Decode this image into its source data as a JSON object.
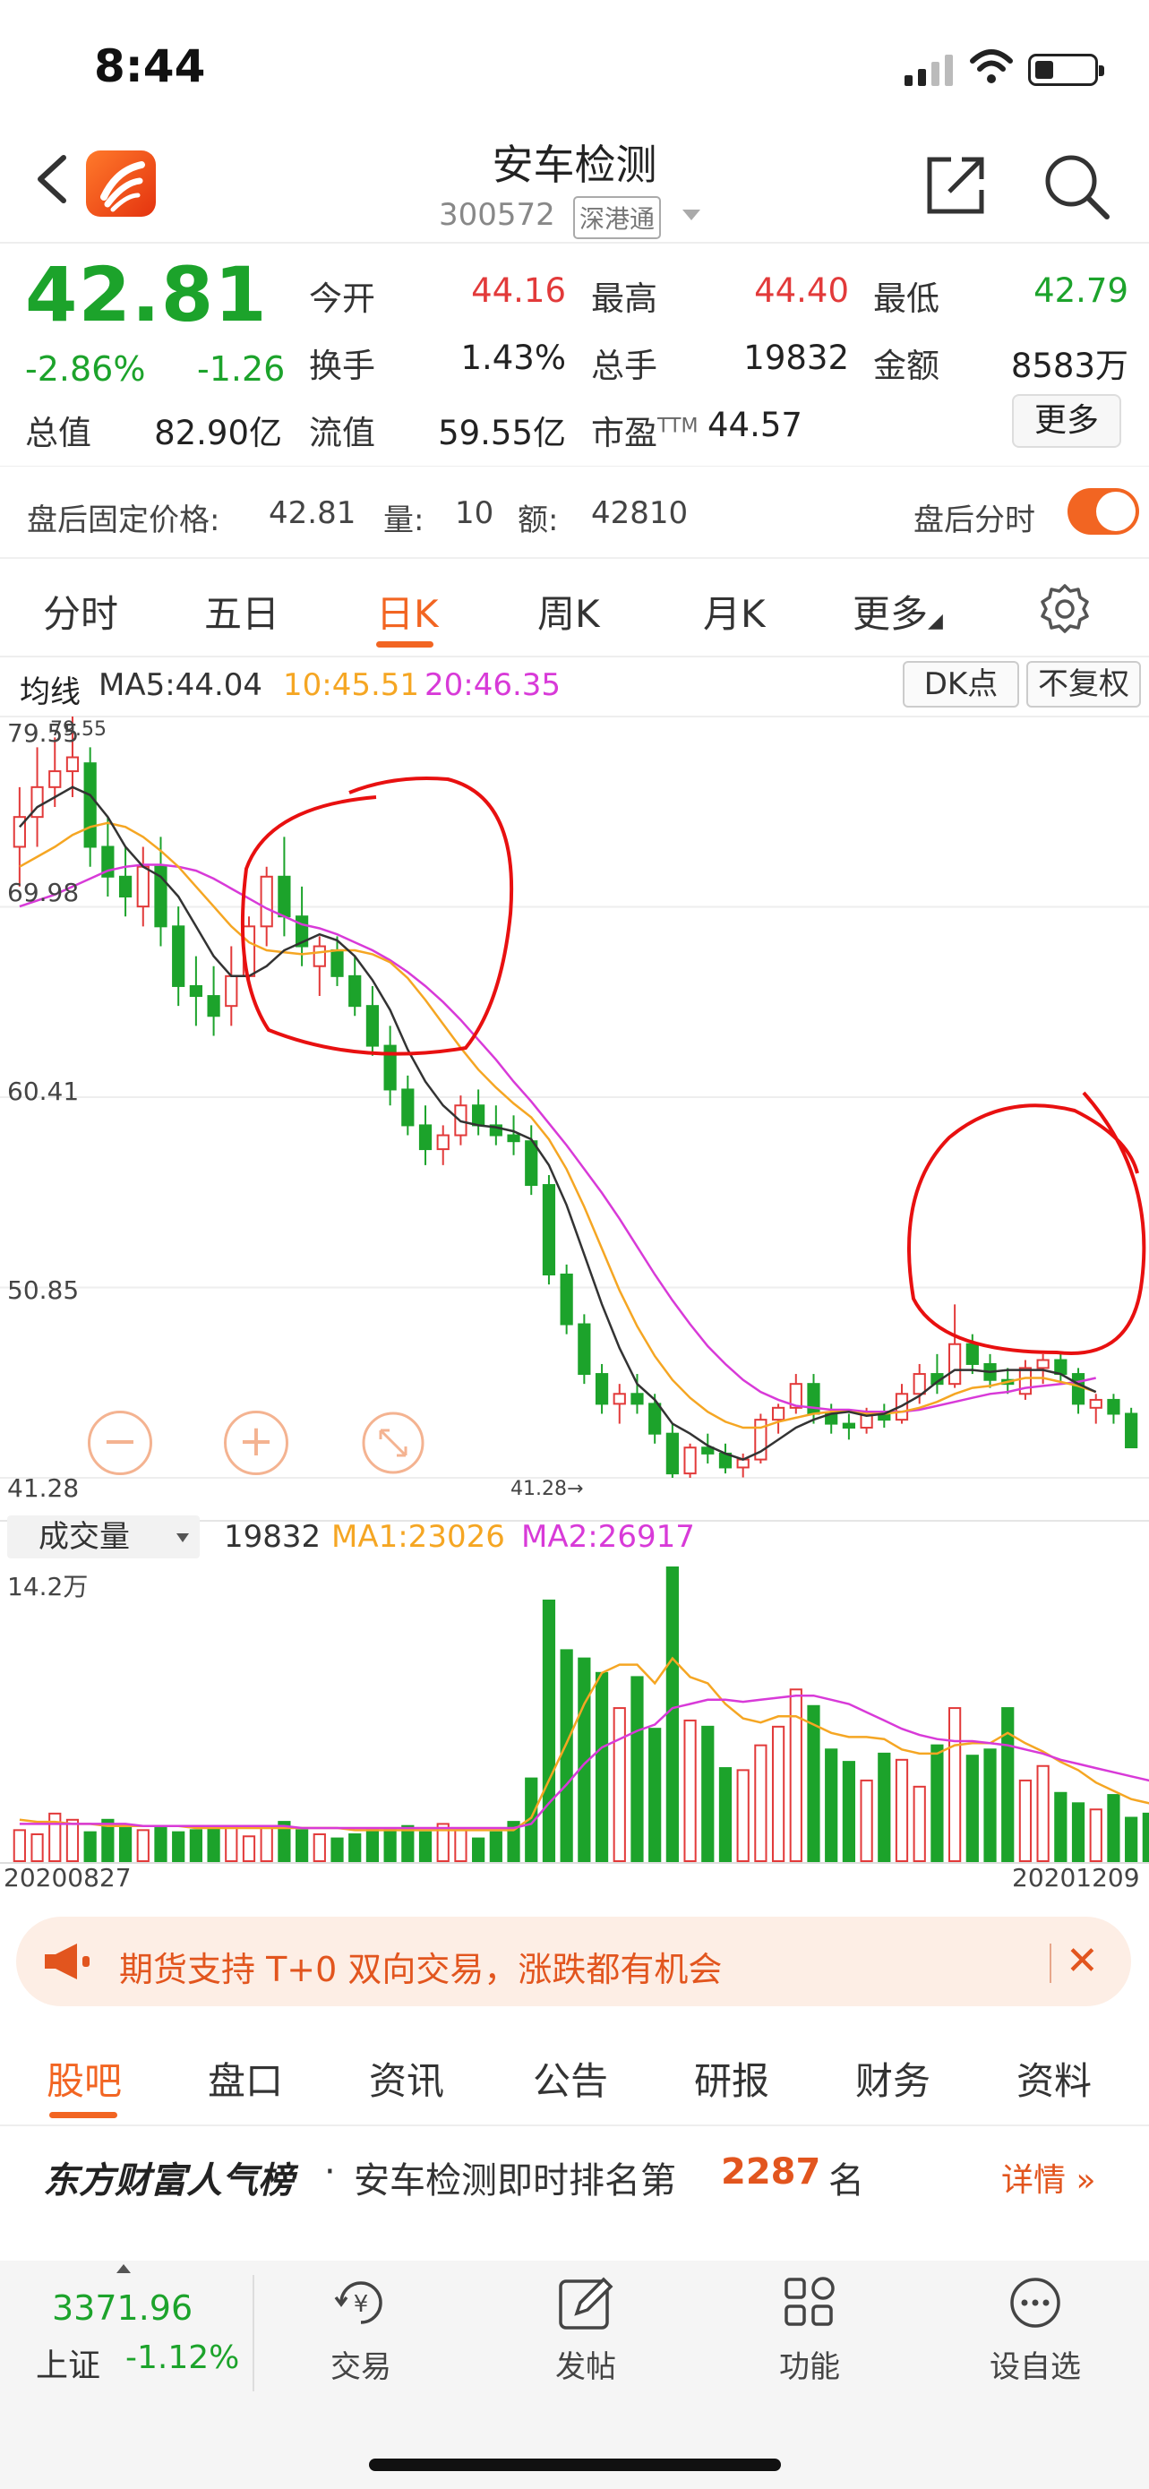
{
  "status": {
    "time": "8:44"
  },
  "header": {
    "title": "安车检测",
    "code": "300572",
    "tag": "深港通"
  },
  "quote": {
    "price": "42.81",
    "pct": "-2.86%",
    "chg": "-1.26",
    "rows": [
      [
        {
          "l": "今开",
          "v": "44.16",
          "c": "red"
        },
        {
          "l": "最高",
          "v": "44.40",
          "c": "red"
        },
        {
          "l": "最低",
          "v": "42.79",
          "c": "green"
        }
      ],
      [
        {
          "l": "换手",
          "v": "1.43%",
          "c": "dark"
        },
        {
          "l": "总手",
          "v": "19832",
          "c": "dark"
        },
        {
          "l": "金额",
          "v": "8583万",
          "c": "dark"
        }
      ]
    ],
    "total_l": "总值",
    "total_v": "82.90亿",
    "float_l": "流值",
    "float_v": "59.55亿",
    "pe_l": "市盈",
    "pe_sup": "TTM",
    "pe_v": "44.57",
    "more": "更多"
  },
  "after_hours": {
    "label": "盘后固定价格:",
    "price": "42.81",
    "vol_l": "量:",
    "vol": "10",
    "amt_l": "额:",
    "amt": "42810",
    "timeshare": "盘后分时",
    "toggle_on": true
  },
  "tabs": [
    "分时",
    "五日",
    "日K",
    "周K",
    "月K",
    "更多"
  ],
  "active_tab": "日K",
  "ma": {
    "label": "均线",
    "ma5": "MA5:44.04",
    "ma10": "10:45.51",
    "ma20": "20:46.35",
    "btn1": "DK点",
    "btn2": "不复权"
  },
  "price_axis": [
    "79.55",
    "69.98",
    "60.41",
    "50.85",
    "41.28"
  ],
  "annotations": {
    "high": "79.55",
    "low": "41.28"
  },
  "volume": {
    "selector": "成交量",
    "value": "19832",
    "ma1": "MA1:23026",
    "ma2": "MA2:26917",
    "max": "14.2万"
  },
  "dates": {
    "start": "20200827",
    "end": "20201209"
  },
  "colors": {
    "up": "#e23a3a",
    "down": "#1ca32b",
    "ma5": "#333333",
    "ma10": "#f5a623",
    "ma20": "#d83ad8",
    "accent": "#f26522"
  },
  "chart_data": {
    "type": "candlestick",
    "ylim": [
      41.28,
      79.55
    ],
    "candles": [
      {
        "o": 73.0,
        "h": 76.0,
        "l": 71.0,
        "c": 74.5
      },
      {
        "o": 74.5,
        "h": 78.0,
        "l": 73.0,
        "c": 76.0
      },
      {
        "o": 76.0,
        "h": 78.5,
        "l": 75.0,
        "c": 76.8
      },
      {
        "o": 76.8,
        "h": 79.55,
        "l": 75.5,
        "c": 77.5
      },
      {
        "o": 77.2,
        "h": 78.0,
        "l": 72.0,
        "c": 73.0
      },
      {
        "o": 73.0,
        "h": 74.5,
        "l": 70.5,
        "c": 71.5
      },
      {
        "o": 71.5,
        "h": 73.0,
        "l": 69.5,
        "c": 70.5
      },
      {
        "o": 70.0,
        "h": 73.0,
        "l": 69.0,
        "c": 72.0
      },
      {
        "o": 72.0,
        "h": 73.5,
        "l": 68.0,
        "c": 69.0
      },
      {
        "o": 69.0,
        "h": 70.0,
        "l": 65.0,
        "c": 66.0
      },
      {
        "o": 66.0,
        "h": 67.5,
        "l": 64.0,
        "c": 65.5
      },
      {
        "o": 65.5,
        "h": 67.0,
        "l": 63.5,
        "c": 64.5
      },
      {
        "o": 65.0,
        "h": 68.0,
        "l": 64.0,
        "c": 66.5
      },
      {
        "o": 66.5,
        "h": 69.5,
        "l": 66.0,
        "c": 69.0
      },
      {
        "o": 69.0,
        "h": 72.0,
        "l": 68.0,
        "c": 71.5
      },
      {
        "o": 71.5,
        "h": 73.5,
        "l": 68.5,
        "c": 69.5
      },
      {
        "o": 69.5,
        "h": 71.0,
        "l": 67.0,
        "c": 68.0
      },
      {
        "o": 67.0,
        "h": 68.5,
        "l": 65.5,
        "c": 68.0
      },
      {
        "o": 67.8,
        "h": 68.5,
        "l": 66.0,
        "c": 66.5
      },
      {
        "o": 66.5,
        "h": 67.5,
        "l": 64.5,
        "c": 65.0
      },
      {
        "o": 65.0,
        "h": 66.0,
        "l": 62.5,
        "c": 63.0
      },
      {
        "o": 63.0,
        "h": 64.0,
        "l": 60.0,
        "c": 60.8
      },
      {
        "o": 60.8,
        "h": 61.5,
        "l": 58.5,
        "c": 59.0
      },
      {
        "o": 59.0,
        "h": 60.0,
        "l": 57.0,
        "c": 57.8
      },
      {
        "o": 57.8,
        "h": 59.0,
        "l": 57.0,
        "c": 58.5
      },
      {
        "o": 58.5,
        "h": 60.5,
        "l": 58.0,
        "c": 60.0
      },
      {
        "o": 60.0,
        "h": 60.8,
        "l": 58.5,
        "c": 59.0
      },
      {
        "o": 59.0,
        "h": 60.0,
        "l": 58.0,
        "c": 58.5
      },
      {
        "o": 58.5,
        "h": 59.5,
        "l": 57.5,
        "c": 58.2
      },
      {
        "o": 58.2,
        "h": 59.0,
        "l": 55.5,
        "c": 56.0
      },
      {
        "o": 56.0,
        "h": 56.5,
        "l": 51.0,
        "c": 51.5
      },
      {
        "o": 51.5,
        "h": 52.0,
        "l": 48.5,
        "c": 49.0
      },
      {
        "o": 49.0,
        "h": 49.5,
        "l": 46.0,
        "c": 46.5
      },
      {
        "o": 46.5,
        "h": 47.0,
        "l": 44.5,
        "c": 45.0
      },
      {
        "o": 45.0,
        "h": 46.0,
        "l": 44.0,
        "c": 45.5
      },
      {
        "o": 45.5,
        "h": 46.5,
        "l": 44.5,
        "c": 45.0
      },
      {
        "o": 45.0,
        "h": 45.5,
        "l": 43.0,
        "c": 43.5
      },
      {
        "o": 43.5,
        "h": 44.0,
        "l": 41.28,
        "c": 41.5
      },
      {
        "o": 41.5,
        "h": 43.0,
        "l": 41.28,
        "c": 42.8
      },
      {
        "o": 42.8,
        "h": 43.5,
        "l": 42.0,
        "c": 42.5
      },
      {
        "o": 42.5,
        "h": 43.0,
        "l": 41.5,
        "c": 41.8
      },
      {
        "o": 41.8,
        "h": 42.5,
        "l": 41.3,
        "c": 42.2
      },
      {
        "o": 42.2,
        "h": 44.5,
        "l": 42.0,
        "c": 44.2
      },
      {
        "o": 44.2,
        "h": 45.0,
        "l": 43.5,
        "c": 44.8
      },
      {
        "o": 44.8,
        "h": 46.5,
        "l": 44.5,
        "c": 46.0
      },
      {
        "o": 46.0,
        "h": 46.5,
        "l": 44.0,
        "c": 44.5
      },
      {
        "o": 44.5,
        "h": 45.0,
        "l": 43.5,
        "c": 44.0
      },
      {
        "o": 44.0,
        "h": 44.5,
        "l": 43.2,
        "c": 43.8
      },
      {
        "o": 43.8,
        "h": 44.8,
        "l": 43.5,
        "c": 44.5
      },
      {
        "o": 44.5,
        "h": 45.0,
        "l": 43.8,
        "c": 44.2
      },
      {
        "o": 44.2,
        "h": 46.0,
        "l": 44.0,
        "c": 45.5
      },
      {
        "o": 45.5,
        "h": 47.0,
        "l": 45.0,
        "c": 46.5
      },
      {
        "o": 46.5,
        "h": 47.5,
        "l": 45.5,
        "c": 46.0
      },
      {
        "o": 46.0,
        "h": 50.0,
        "l": 45.8,
        "c": 48.0
      },
      {
        "o": 48.0,
        "h": 48.5,
        "l": 46.5,
        "c": 47.0
      },
      {
        "o": 47.0,
        "h": 47.5,
        "l": 45.8,
        "c": 46.2
      },
      {
        "o": 46.2,
        "h": 46.8,
        "l": 45.5,
        "c": 46.0
      },
      {
        "o": 45.5,
        "h": 47.2,
        "l": 45.2,
        "c": 46.8
      },
      {
        "o": 46.8,
        "h": 47.5,
        "l": 46.0,
        "c": 47.2
      },
      {
        "o": 47.2,
        "h": 47.5,
        "l": 46.0,
        "c": 46.5
      },
      {
        "o": 46.5,
        "h": 46.8,
        "l": 44.5,
        "c": 45.0
      },
      {
        "o": 44.8,
        "h": 45.5,
        "l": 44.0,
        "c": 45.2
      },
      {
        "o": 45.2,
        "h": 45.5,
        "l": 44.0,
        "c": 44.5
      },
      {
        "o": 44.5,
        "h": 44.8,
        "l": 42.79,
        "c": 42.81
      }
    ],
    "ma5": [
      74,
      75,
      75.5,
      76,
      75.6,
      74.5,
      73,
      72,
      71.5,
      70.5,
      69,
      67.5,
      66.5,
      66.5,
      67,
      67.8,
      68.2,
      68.6,
      68.3,
      67.5,
      66.3,
      64.8,
      62.8,
      61.2,
      60,
      59.2,
      59,
      58.9,
      58.7,
      58.3,
      57,
      55,
      52.5,
      50,
      47.8,
      46,
      45.2,
      44,
      43.5,
      42.9,
      42.5,
      42.2,
      42.6,
      43.2,
      43.8,
      44.2,
      44.5,
      44.6,
      44.4,
      44.5,
      44.9,
      45.4,
      46.1,
      46.7,
      46.7,
      46.6,
      46.7,
      46.7,
      46.7,
      46.5,
      46,
      45.6
    ],
    "ma10": [
      72,
      72.5,
      73,
      73.6,
      74,
      74.2,
      74,
      73.5,
      72.8,
      72,
      71,
      70,
      69,
      68.2,
      67.8,
      67.7,
      67.6,
      67.7,
      67.8,
      67.8,
      67.6,
      67.2,
      66.4,
      65.3,
      64.1,
      62.9,
      61.8,
      60.9,
      60.1,
      59.4,
      58.3,
      56.8,
      54.9,
      52.8,
      50.7,
      48.9,
      47.4,
      46.2,
      45.3,
      44.6,
      44.1,
      43.8,
      43.8,
      44.1,
      44.3,
      44.5,
      44.6,
      44.6,
      44.5,
      44.5,
      44.6,
      44.8,
      45.1,
      45.5,
      45.8,
      45.9,
      46.1,
      46.3,
      46.3,
      46.1,
      45.9,
      45.6
    ],
    "ma20": [
      70,
      70.3,
      70.6,
      71,
      71.4,
      71.8,
      72,
      72.1,
      72.1,
      72,
      71.8,
      71.4,
      70.9,
      70.4,
      69.9,
      69.5,
      69.1,
      68.9,
      68.6,
      68.2,
      67.8,
      67.3,
      66.7,
      66,
      65.2,
      64.3,
      63.3,
      62.3,
      61.2,
      60.2,
      59.1,
      58,
      56.8,
      55.6,
      54.3,
      52.9,
      51.5,
      50.2,
      49,
      47.9,
      47,
      46.2,
      45.6,
      45.2,
      44.9,
      44.8,
      44.7,
      44.7,
      44.6,
      44.6,
      44.6,
      44.7,
      44.9,
      45.1,
      45.3,
      45.5,
      45.6,
      45.8,
      45.9,
      46,
      46.1,
      46.3
    ],
    "volume": [
      1.5,
      1.3,
      2.3,
      2.0,
      1.4,
      2.0,
      1.6,
      1.5,
      1.6,
      1.4,
      1.5,
      1.6,
      1.7,
      1.2,
      1.6,
      1.9,
      1.5,
      1.3,
      1.1,
      1.3,
      1.6,
      1.6,
      1.7,
      1.4,
      1.8,
      1.5,
      1.1,
      1.4,
      1.9,
      4.0,
      12.6,
      10.2,
      9.8,
      9.1,
      7.4,
      8.9,
      6.4,
      14.2,
      6.8,
      6.5,
      4.5,
      4.4,
      5.6,
      6.5,
      8.3,
      7.5,
      5.4,
      4.8,
      3.9,
      5.2,
      4.9,
      3.6,
      5.6,
      7.4,
      5.1,
      5.4,
      7.4,
      3.9,
      4.6,
      3.3,
      2.8,
      2.5,
      3.2,
      2.1,
      2.3,
      1.8,
      3.2,
      1.7,
      1.2,
      1.9
    ],
    "vol_ma1": [
      2.0,
      1.9,
      1.9,
      1.8,
      1.8,
      1.7,
      1.7,
      1.7,
      1.7,
      1.7,
      1.6,
      1.6,
      1.6,
      1.6,
      1.6,
      1.6,
      1.6,
      1.6,
      1.6,
      1.5,
      1.5,
      1.5,
      1.5,
      1.5,
      1.5,
      1.5,
      1.5,
      1.5,
      1.5,
      2.1,
      3.9,
      5.7,
      7.6,
      9.1,
      9.5,
      9.5,
      8.6,
      9.8,
      8.9,
      8.6,
      7.6,
      6.9,
      6.7,
      7.0,
      7.0,
      6.6,
      6.2,
      6.0,
      6.0,
      5.9,
      5.4,
      5.2,
      5.2,
      5.6,
      5.7,
      5.7,
      6.2,
      5.7,
      5.3,
      4.8,
      4.4,
      3.8,
      3.4,
      3.0,
      2.8,
      2.7,
      2.6,
      2.5,
      2.4,
      2.3
    ],
    "vol_ma2": [
      1.8,
      1.8,
      1.8,
      1.8,
      1.8,
      1.8,
      1.8,
      1.7,
      1.7,
      1.7,
      1.7,
      1.7,
      1.7,
      1.7,
      1.7,
      1.7,
      1.6,
      1.6,
      1.6,
      1.6,
      1.6,
      1.6,
      1.6,
      1.6,
      1.6,
      1.6,
      1.6,
      1.6,
      1.6,
      1.8,
      2.8,
      3.7,
      4.7,
      5.5,
      5.9,
      6.3,
      6.6,
      7.4,
      7.6,
      7.8,
      7.8,
      7.7,
      7.8,
      7.9,
      8.0,
      8.0,
      7.8,
      7.6,
      7.2,
      6.8,
      6.4,
      6.1,
      5.9,
      5.8,
      5.8,
      5.7,
      5.6,
      5.4,
      5.2,
      4.9,
      4.7,
      4.5,
      4.3,
      4.1,
      3.9,
      3.7,
      3.5,
      3.3,
      3.2,
      3.1
    ]
  },
  "banner": {
    "text": "期货支持 T+0 双向交易，涨跌都有机会"
  },
  "bottom_tabs": [
    "股吧",
    "盘口",
    "资讯",
    "公告",
    "研报",
    "财务",
    "资料"
  ],
  "rank": {
    "brand": "东方财富人气榜",
    "sep": "·",
    "text": "安车检测即时排名第",
    "num": "2287",
    "unit": "名",
    "detail": "详情"
  },
  "nav": {
    "index_value": "3371.96",
    "index_name": "上证",
    "index_chg": "-1.12%",
    "items": [
      "交易",
      "发帖",
      "功能",
      "设自选"
    ]
  }
}
